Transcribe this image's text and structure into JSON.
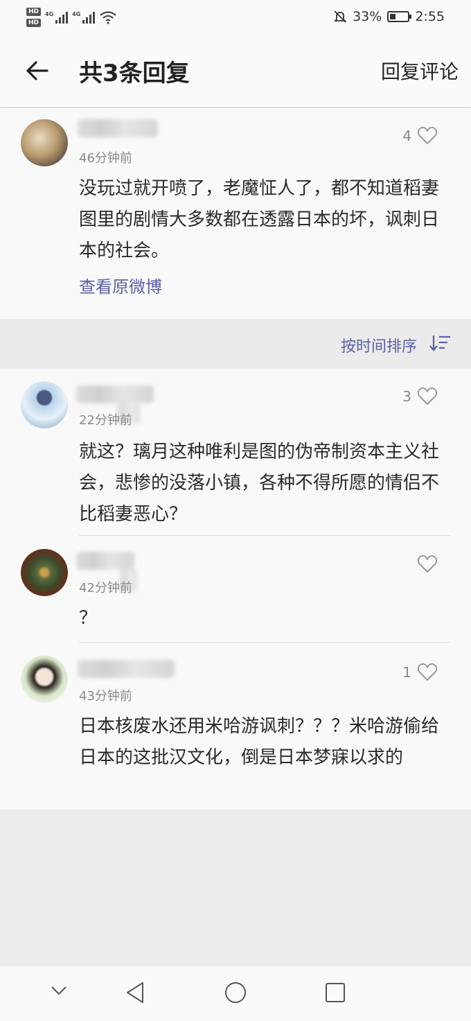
{
  "status_bar": {
    "hd1": "HD",
    "hd2": "HD",
    "net1": "4G",
    "net2": "4G",
    "battery_pct": "33%",
    "battery_level": 0.33,
    "time": "2:55"
  },
  "header": {
    "title": "共3条回复",
    "reply_button": "回复评论"
  },
  "main_comment": {
    "time": "46分钟前",
    "likes": "4",
    "text": "没玩过就开喷了，老魔怔人了，都不知道稻妻图里的剧情大多数都在透露日本的坏，讽刺日本的社会。",
    "link": "查看原微博"
  },
  "sort": {
    "label": "按时间排序"
  },
  "replies": [
    {
      "time": "22分钟前",
      "likes": "3",
      "text": "就这？璃月这种唯利是图的伪帝制资本主义社会，悲惨的没落小镇，各种不得所愿的情侣不比稻妻恶心？"
    },
    {
      "time": "42分钟前",
      "likes": "",
      "text": "？"
    },
    {
      "time": "43分钟前",
      "likes": "1",
      "text": "日本核废水还用米哈游讽刺？？？米哈游偷给日本的这批汉文化，倒是日本梦寐以求的"
    }
  ],
  "icons": {
    "back": "arrow-left-icon",
    "heart": "heart-icon",
    "sort": "sort-icon",
    "mute": "bell-off-icon",
    "wifi": "wifi-icon"
  },
  "colors": {
    "accent": "#5b5fa8"
  }
}
